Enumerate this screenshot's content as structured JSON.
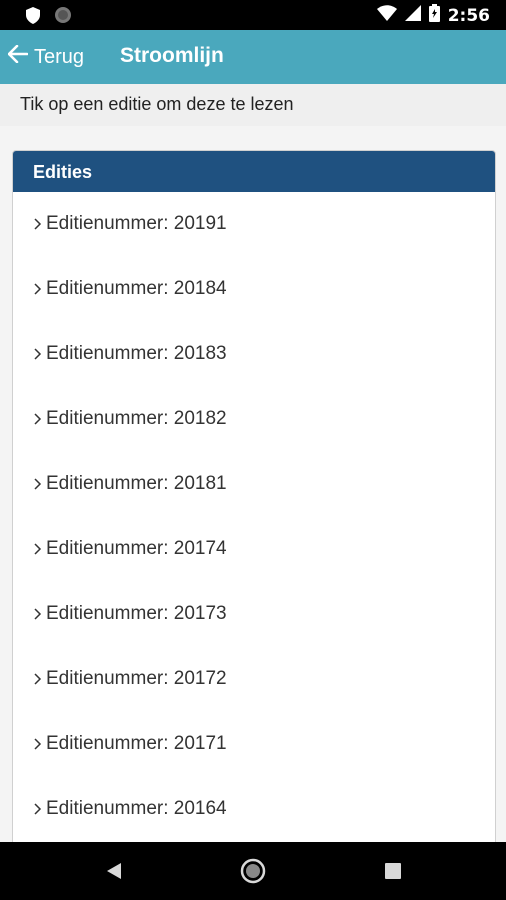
{
  "status_bar": {
    "time": "2:56"
  },
  "app_bar": {
    "back_label": "Terug",
    "title": "Stroomlijn"
  },
  "hint": "Tik op een editie om deze te lezen",
  "panel": {
    "heading": "Edities",
    "items": [
      "Editienummer: 20191",
      "Editienummer: 20184",
      "Editienummer: 20183",
      "Editienummer: 20182",
      "Editienummer: 20181",
      "Editienummer: 20174",
      "Editienummer: 20173",
      "Editienummer: 20172",
      "Editienummer: 20171",
      "Editienummer: 20164"
    ]
  },
  "colors": {
    "app_bar": "#4aa8bd",
    "panel_header": "#1f5180"
  },
  "icons": [
    "shield-icon",
    "circle-icon",
    "wifi-icon",
    "signal-icon",
    "battery-icon",
    "arrow-left-icon",
    "chevron-right-icon",
    "nav-back-icon",
    "nav-home-icon",
    "nav-recents-icon"
  ]
}
